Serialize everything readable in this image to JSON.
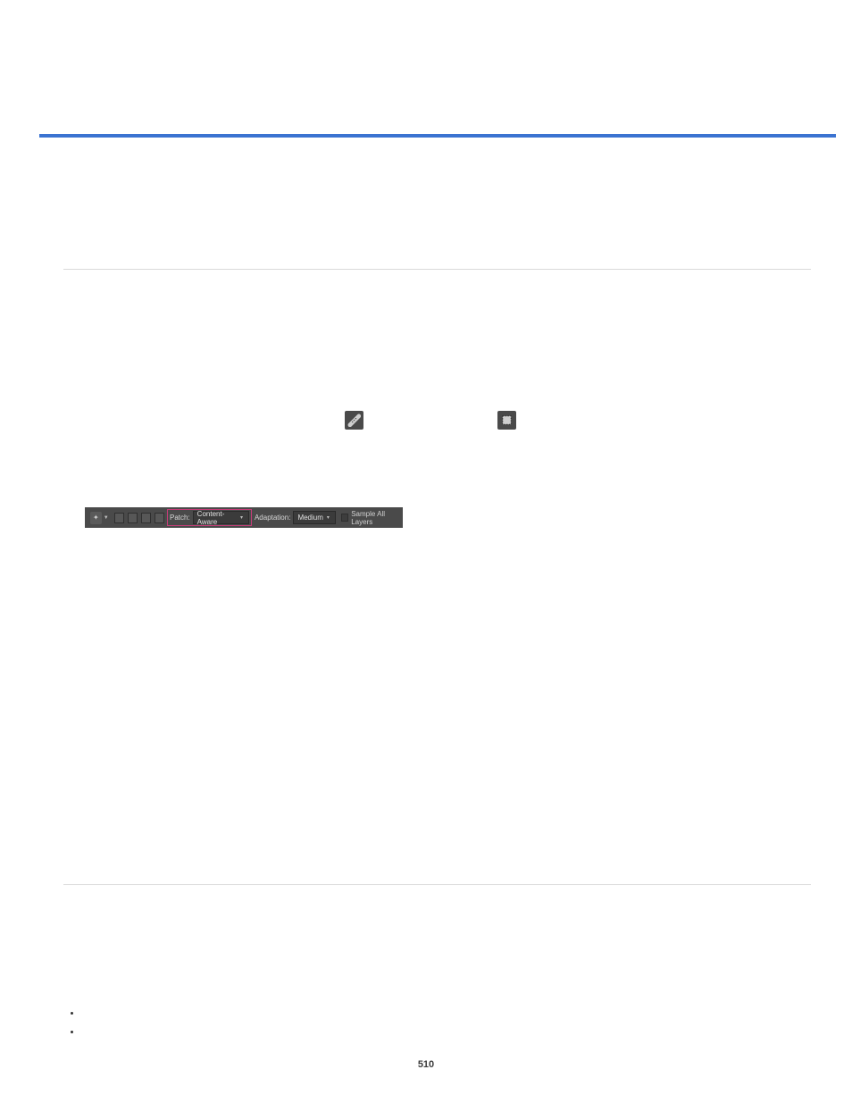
{
  "icons": {
    "heal": "✦",
    "patch": "▦"
  },
  "toolbar": {
    "tool_icon": "✦",
    "patch_label": "Patch:",
    "patch_value": "Content-Aware",
    "adaptation_label": "Adaptation:",
    "adaptation_value": "Medium",
    "sample_all_label": "Sample All Layers"
  },
  "bullets": [
    "",
    ""
  ],
  "page_number": "510"
}
